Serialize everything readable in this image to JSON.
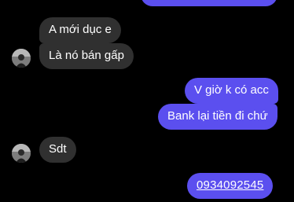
{
  "messages": [
    {
      "text": "A mới dục e"
    },
    {
      "text": "Là nó bán gấp"
    },
    {
      "text": "V giờ k có acc"
    },
    {
      "text": "Bank lại tiền đi chứ"
    },
    {
      "text": "Sdt"
    },
    {
      "text": "0934092545"
    }
  ],
  "colors": {
    "background": "#000000",
    "incoming_bubble": "#303030",
    "outgoing_bubble": "#5b4fef",
    "text": "#ffffff"
  },
  "icons": {
    "avatar": "contact-avatar"
  }
}
